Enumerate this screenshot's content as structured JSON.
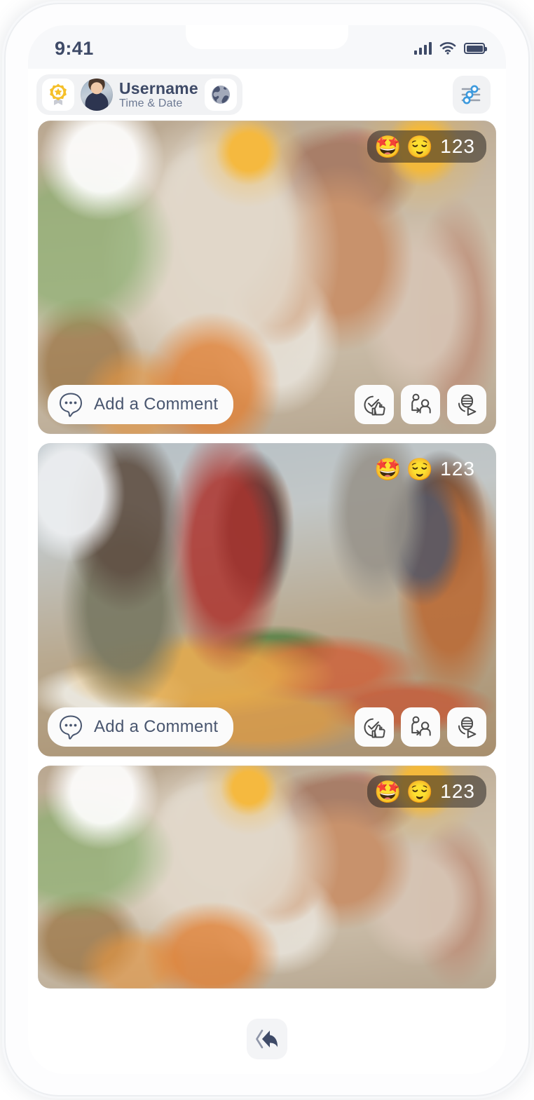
{
  "status_bar": {
    "time": "9:41",
    "icons": [
      "cellular-signal-icon",
      "wifi-icon",
      "battery-icon"
    ]
  },
  "top_bar": {
    "badge_icon": "verified-badge-icon",
    "avatar": "user-avatar",
    "username": "Username",
    "time_and_date": "Time & Date",
    "globe_icon": "globe-icon",
    "filter_icon": "sliders-filter-icon"
  },
  "feed": {
    "posts": [
      {
        "photo": "family-dinner-photo",
        "badge_style": "pill",
        "reactions": [
          "🤩",
          "😌"
        ],
        "reaction_count": "123",
        "comment_placeholder": "Add a Comment",
        "comment_icon": "comment-bubble-icon",
        "actions": [
          {
            "icon": "thumbs-up-check-icon",
            "name": "approve-button"
          },
          {
            "icon": "share-to-person-icon",
            "name": "share-button"
          },
          {
            "icon": "voice-play-icon",
            "name": "voice-note-button"
          }
        ]
      },
      {
        "photo": "street-food-market-photo",
        "badge_style": "flat",
        "reactions": [
          "🤩",
          "😌"
        ],
        "reaction_count": "123",
        "comment_placeholder": "Add a Comment",
        "comment_icon": "comment-bubble-icon",
        "actions": [
          {
            "icon": "thumbs-up-check-icon",
            "name": "approve-button"
          },
          {
            "icon": "share-to-person-icon",
            "name": "share-button"
          },
          {
            "icon": "voice-play-icon",
            "name": "voice-note-button"
          }
        ]
      },
      {
        "photo": "family-dinner-photo",
        "badge_style": "pill",
        "reactions": [
          "🤩",
          "😌"
        ],
        "reaction_count": "123"
      }
    ]
  },
  "bottom_bar": {
    "back_icon": "back-reply-arrow-icon"
  },
  "colors": {
    "accent_blue": "#3c9ade",
    "text_navy": "#3e4a67",
    "muted_navy": "#6c7993",
    "chip_grey": "#f1f2f4",
    "badge_gold": "#f5c02a",
    "tile_white": "#fbfbfb"
  }
}
